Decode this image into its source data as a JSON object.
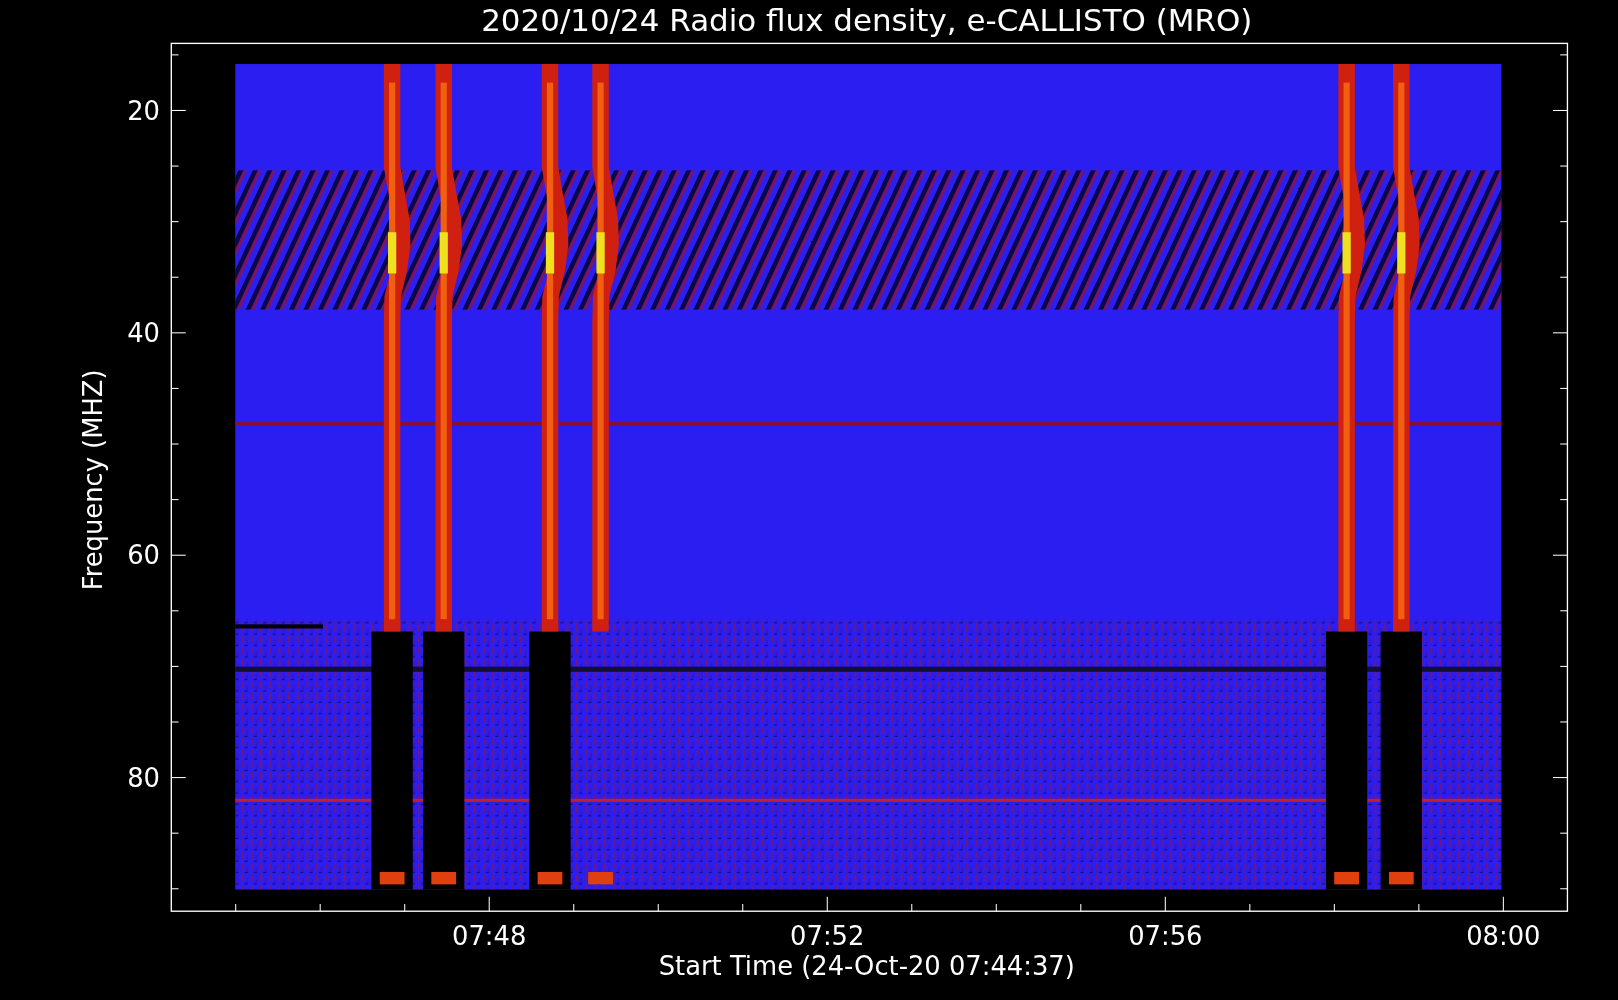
{
  "title": "2020/10/24  Radio flux density, e-CALLISTO (MRO)",
  "chart": {
    "ylabel": "Frequency (MHZ)",
    "xlabel": "Start Time (24-Oct-20 07:44:37)",
    "yticks": [
      "20",
      "40",
      "60",
      "80"
    ],
    "xticks": [
      "07:48",
      "07:52",
      "07:56",
      "08:00"
    ]
  }
}
